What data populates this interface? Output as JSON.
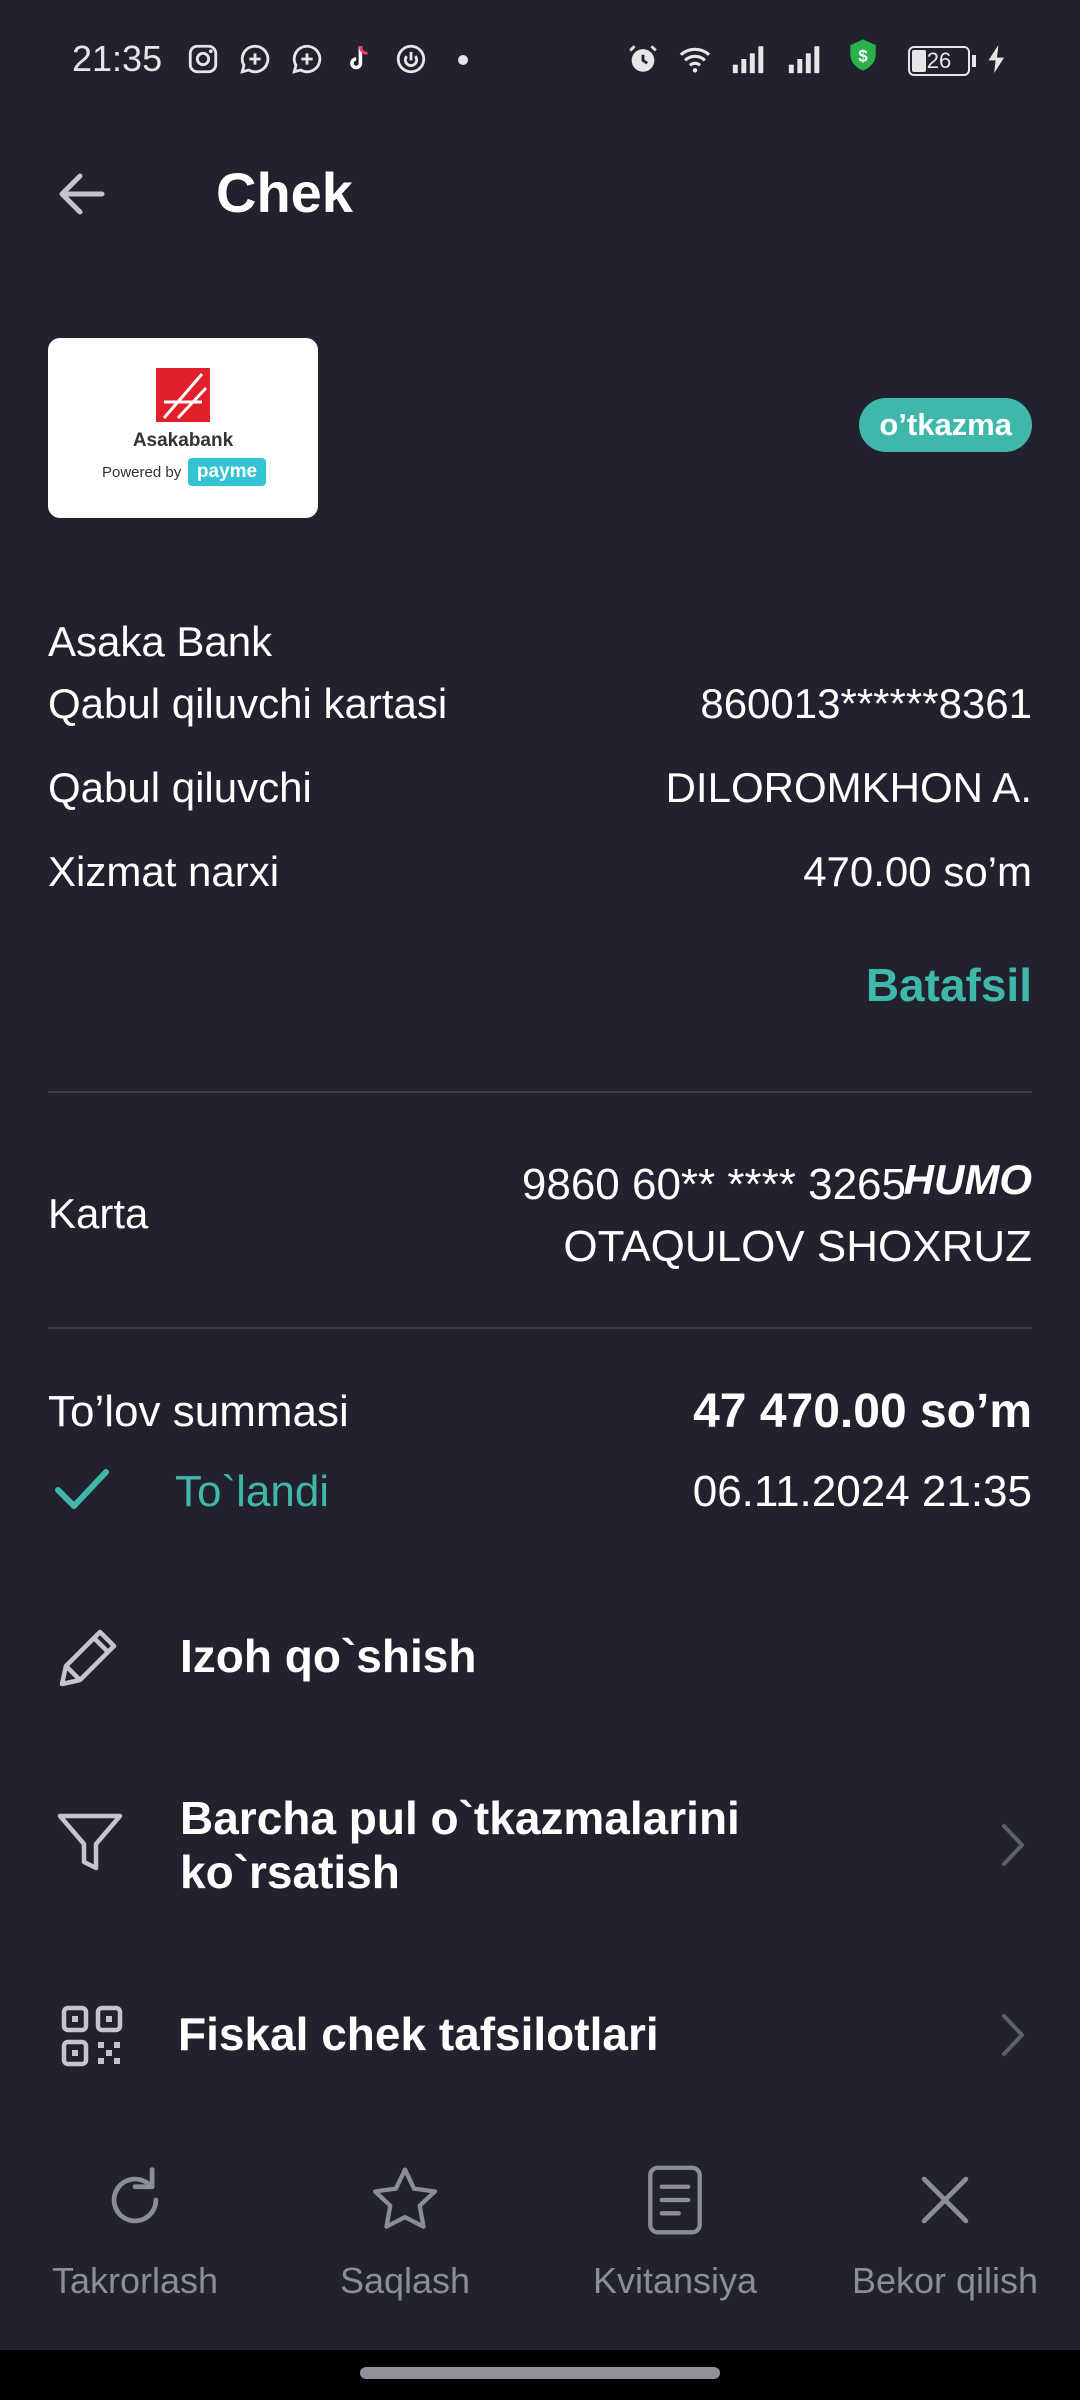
{
  "status_bar": {
    "time": "21:35",
    "battery": "26",
    "icons": [
      "instagram-icon",
      "chat-icon",
      "chat-icon",
      "tiktok-icon",
      "power-icon",
      "dot-icon",
      "alarm-icon",
      "wifi-icon",
      "signal-icon",
      "signal-icon",
      "shield-dollar-icon",
      "battery-icon",
      "charging-icon"
    ]
  },
  "header": {
    "title": "Chek"
  },
  "merchant": {
    "logo_name": "Asakabank",
    "logo_powered": "Powered by",
    "logo_brand": "payme",
    "badge": "o’tkazma",
    "name": "Asaka Bank"
  },
  "details": {
    "card_label": "Qabul qiluvchi kartasi",
    "card_value": "860013******8361",
    "recipient_label": "Qabul qiluvchi",
    "recipient_value": "DILOROMKHON A.",
    "fee_label": "Xizmat narxi",
    "fee_value": "470.00 so’m",
    "more_link": "Batafsil"
  },
  "payer": {
    "label": "Karta",
    "card_number": "9860 60** **** 3265",
    "card_brand": "HUMO",
    "holder": "OTAQULOV SHOXRUZ"
  },
  "payment": {
    "label": "To’lov summasi",
    "amount": "47 470.00 so’m",
    "status": "To`landi",
    "datetime": "06.11.2024 21:35"
  },
  "actions": [
    {
      "label": "Izoh qo`shish"
    },
    {
      "label_line1": "Barcha pul o`tkazmalarini",
      "label_line2": "ko`rsatish"
    },
    {
      "label": "Fiskal chek tafsilotlari"
    }
  ],
  "bottom_nav": [
    {
      "label": "Takrorlash",
      "icon": "repeat-icon"
    },
    {
      "label": "Saqlash",
      "icon": "star-icon"
    },
    {
      "label": "Kvitansiya",
      "icon": "receipt-icon"
    },
    {
      "label": "Bekor qilish",
      "icon": "close-icon"
    }
  ],
  "colors": {
    "background": "#21222d",
    "accent": "#3fb7aa",
    "muted": "#8b8e99"
  }
}
